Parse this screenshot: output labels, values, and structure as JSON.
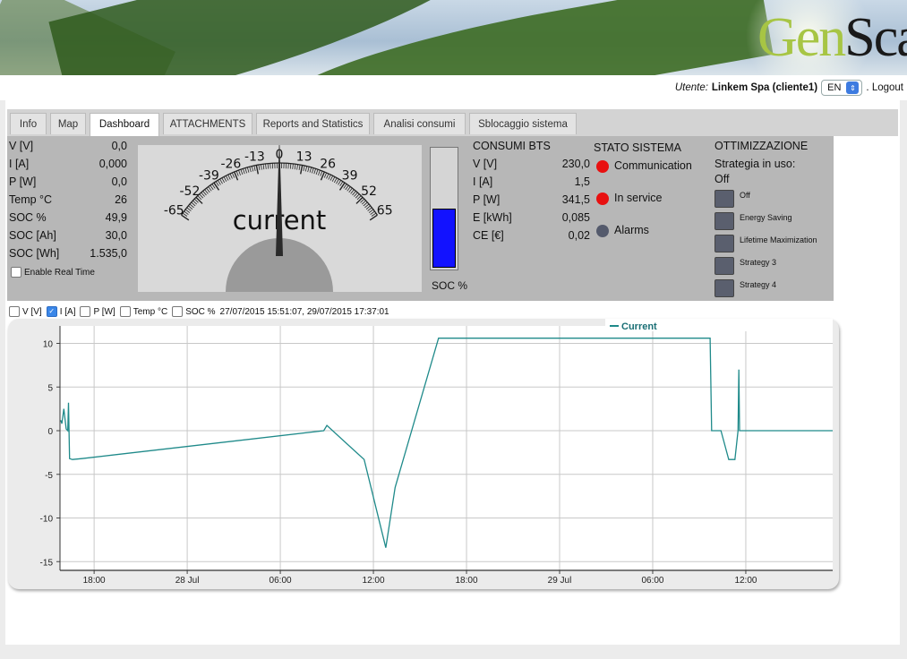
{
  "header": {
    "logo_part1": "Gen",
    "logo_part2": "Scada",
    "user_label": "Utente:",
    "user_name": "Linkem Spa (cliente1)",
    "language": "EN",
    "logout_label": "Logout"
  },
  "tabs": [
    {
      "label": "Info",
      "active": false
    },
    {
      "label": "Map",
      "active": false
    },
    {
      "label": "Dashboard",
      "active": true
    },
    {
      "label": "ATTACHMENTS",
      "active": false
    },
    {
      "label": "Reports and Statistics",
      "active": false
    },
    {
      "label": "Analisi consumi",
      "active": false
    },
    {
      "label": "Sblocaggio sistema",
      "active": false
    }
  ],
  "measures": [
    {
      "label": "V [V]",
      "value": "0,0"
    },
    {
      "label": "I [A]",
      "value": "0,000"
    },
    {
      "label": "P [W]",
      "value": "0,0"
    },
    {
      "label": "Temp °C",
      "value": "26"
    },
    {
      "label": "SOC %",
      "value": "49,9"
    },
    {
      "label": "SOC [Ah]",
      "value": "30,0"
    },
    {
      "label": "SOC [Wh]",
      "value": "1.535,0"
    }
  ],
  "realtime_label": "Enable Real Time",
  "gauge": {
    "title": "current",
    "ticks": [
      "-65",
      "-52",
      "-39",
      "-26",
      "-13",
      "0",
      "13",
      "26",
      "39",
      "52",
      "65"
    ],
    "value": 0,
    "min": -65,
    "max": 65
  },
  "soc": {
    "label": "SOC %",
    "fraction": 0.499
  },
  "consumi": {
    "title": "CONSUMI BTS",
    "rows": [
      {
        "label": "V [V]",
        "value": "230,0"
      },
      {
        "label": "I [A]",
        "value": "1,5"
      },
      {
        "label": "P [W]",
        "value": "341,5"
      },
      {
        "label": "E [kWh]",
        "value": "0,085"
      },
      {
        "label": "CE [€]",
        "value": "0,02"
      }
    ]
  },
  "stato": {
    "title": "STATO SISTEMA",
    "items": [
      {
        "label": "Communication",
        "color": "#e81010"
      },
      {
        "label": "In service",
        "color": "#e81010"
      },
      {
        "label": "Alarms",
        "color": "#545a6c"
      }
    ]
  },
  "ottimizzazione": {
    "title": "OTTIMIZZAZIONE",
    "strategy_label": "Strategia in uso:",
    "strategy_value": "Off",
    "options": [
      "Off",
      "Energy Saving",
      "Lifetime Maximization",
      "Strategy 3",
      "Strategy 4"
    ]
  },
  "series_checkboxes": [
    {
      "label": "V [V]",
      "checked": false
    },
    {
      "label": "I [A]",
      "checked": true
    },
    {
      "label": "P [W]",
      "checked": false
    },
    {
      "label": "Temp °C",
      "checked": false
    },
    {
      "label": "SOC %",
      "checked": false
    }
  ],
  "date_range": "27/07/2015 15:51:07, 29/07/2015 17:37:01",
  "chart_data": {
    "type": "line",
    "legend": [
      "Current"
    ],
    "legend_position": "top-right",
    "grid": true,
    "line_color": "#1f8a8a",
    "x_unit": "hours since 27/07/2015 00:00",
    "xlim": [
      15.8,
      65.6
    ],
    "ylim": [
      -16,
      12
    ],
    "y_ticks": [
      10,
      5,
      0,
      -5,
      -10,
      -15
    ],
    "x_ticks": [
      {
        "t": 18,
        "label": "18:00"
      },
      {
        "t": 24,
        "label": "28 Jul"
      },
      {
        "t": 30,
        "label": "06:00"
      },
      {
        "t": 36,
        "label": "12:00"
      },
      {
        "t": 42,
        "label": "18:00"
      },
      {
        "t": 48,
        "label": "29 Jul"
      },
      {
        "t": 54,
        "label": "06:00"
      },
      {
        "t": 60,
        "label": "12:00"
      }
    ],
    "series": [
      {
        "name": "Current",
        "points": [
          [
            15.85,
            1.2
          ],
          [
            15.92,
            0.8
          ],
          [
            16.05,
            2.5
          ],
          [
            16.2,
            0.2
          ],
          [
            16.3,
            0.0
          ],
          [
            16.35,
            3.2
          ],
          [
            16.42,
            -3.2
          ],
          [
            16.6,
            -3.3
          ],
          [
            17.2,
            -3.2
          ],
          [
            32.8,
            0.0
          ],
          [
            33.0,
            0.6
          ],
          [
            35.4,
            -3.3
          ],
          [
            36.8,
            -13.4
          ],
          [
            37.4,
            -6.5
          ],
          [
            40.2,
            10.6
          ],
          [
            57.7,
            10.6
          ],
          [
            57.8,
            0.0
          ],
          [
            58.4,
            0.0
          ],
          [
            58.9,
            -3.3
          ],
          [
            59.3,
            -3.3
          ],
          [
            59.5,
            0.0
          ],
          [
            59.55,
            7.0
          ],
          [
            59.6,
            0.0
          ],
          [
            65.6,
            0.0
          ]
        ]
      }
    ]
  }
}
